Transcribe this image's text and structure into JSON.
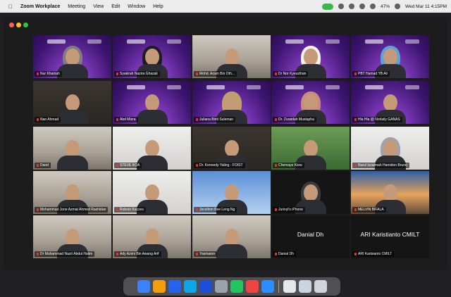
{
  "menubar": {
    "apple_glyph": "",
    "items": [
      "Zoom Workplace",
      "Meeting",
      "View",
      "Edit",
      "Window",
      "Help"
    ],
    "battery": "47%",
    "clock": "Wed Mar 11 4:15PM"
  },
  "participants": [
    {
      "name": "Nur Khairiah",
      "style": "purple",
      "speaker": true,
      "hijab": "#7c7c82"
    },
    {
      "name": "Syakirah Nazira Ghazali",
      "style": "purple",
      "hijab": "#1d1d22"
    },
    {
      "name": "Mohd. Azam Bin Oth...",
      "style": "room"
    },
    {
      "name": "Dr Nor Kyeuzihan",
      "style": "purple",
      "hijab": "#f2f2f2"
    },
    {
      "name": "PBT Hamad YB Ali",
      "style": "purple",
      "hijab": "#5aa2d8"
    },
    {
      "name": "Nan Ahmad",
      "style": "dark"
    },
    {
      "name": "Abd Mizra",
      "style": "purple"
    },
    {
      "name": "Juliana Binti Suleman",
      "style": "purple",
      "hijab": "#bfa06a"
    },
    {
      "name": "Dr. Zuraidah Mustapha",
      "style": "purple",
      "hijab": "#c98b7e"
    },
    {
      "name": "Hla Hla @ Norlaily GANAS",
      "style": "purple"
    },
    {
      "name": "Dand",
      "style": "room"
    },
    {
      "name": "STEVE KOA",
      "style": "light"
    },
    {
      "name": "Dr. Kennedy Yaling - FOIST",
      "style": "dark"
    },
    {
      "name": "Chemaye Kiew",
      "style": "green"
    },
    {
      "name": "Nurul Izzatmah Hamidon Bruno",
      "style": "light",
      "hijab": "#9fa2a8"
    },
    {
      "name": "Mohammad Jone Azmat Ahmed Rashidan",
      "style": "room"
    },
    {
      "name": "Roboto Kaczes",
      "style": "light"
    },
    {
      "name": "Jocelinm Bee Leng Ng",
      "style": "blue"
    },
    {
      "name": "Jurinyl's iPhone",
      "style": "black",
      "hijab": "#3a3a3a"
    },
    {
      "name": "MELVIN BIFALA",
      "style": "sunset"
    },
    {
      "name": "Dr Muhammad Nazri Abdul Halim",
      "style": "room"
    },
    {
      "name": "Ady Azimi Bin Awang Arif",
      "style": "room"
    },
    {
      "name": "Yasmaton",
      "style": "room"
    },
    {
      "name": "Danial Dh",
      "style": "black",
      "big": "Danial Dh"
    },
    {
      "name": "ARI Kartsianto CMILT",
      "style": "black",
      "big": "ARI Karistianto CMILT"
    }
  ],
  "dock": {
    "icons": [
      "finder-icon",
      "photos-icon",
      "app-store-icon",
      "safari-icon",
      "mail-icon",
      "system-settings-icon",
      "messages-icon",
      "music-icon",
      "zoom-icon",
      "preview-icon",
      "keyboard-icon",
      "trash-icon"
    ],
    "colors": [
      "#3b82f6",
      "#f59e0b",
      "#2563eb",
      "#0ea5e9",
      "#1d4ed8",
      "#9ca3af",
      "#22c55e",
      "#ef4444",
      "#2d8cff",
      "#e5e7eb",
      "#cbd5e1",
      "#d1d5db"
    ]
  },
  "colors": {
    "active_speaker": "#3fd05a",
    "zoom_indicator": "#3db84a"
  }
}
